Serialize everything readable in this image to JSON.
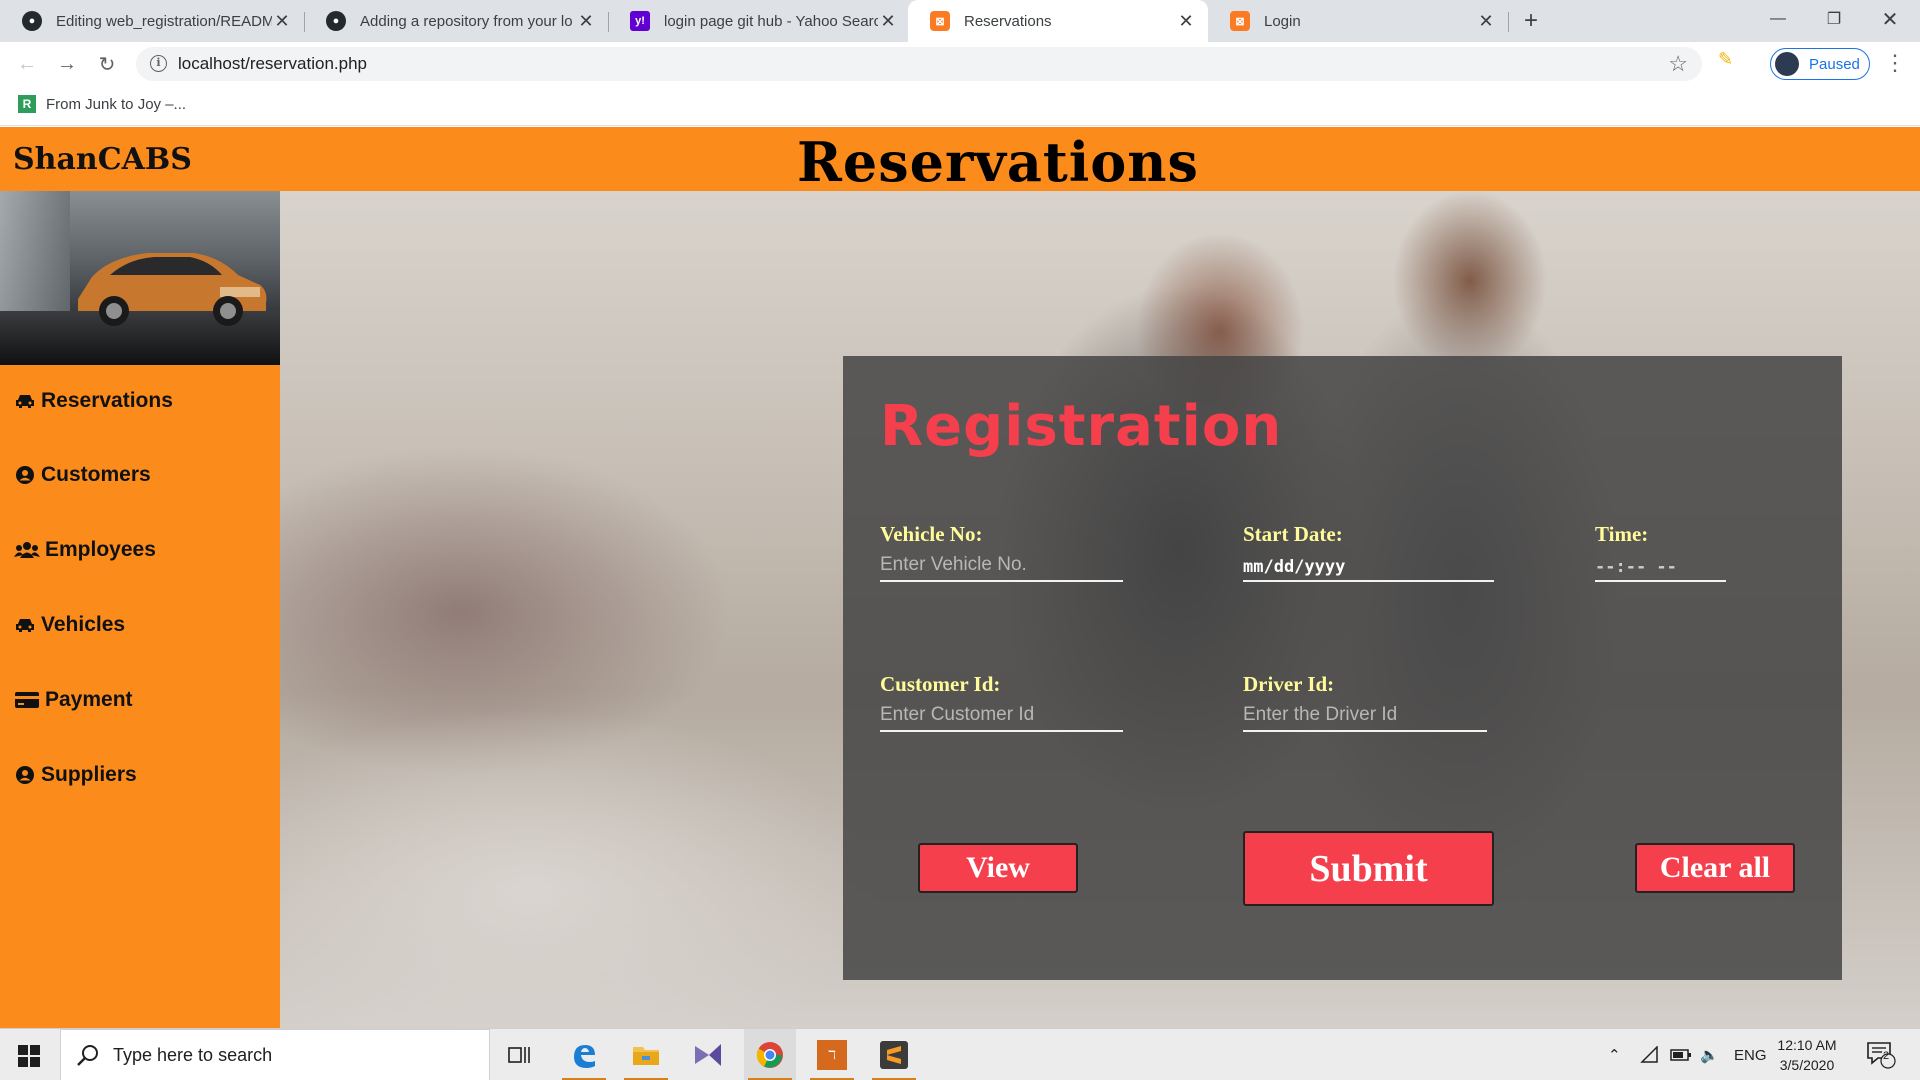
{
  "browser": {
    "tabs": [
      {
        "title": "Editing web_registration/READM",
        "favicon": "github-icon"
      },
      {
        "title": "Adding a repository from your lo",
        "favicon": "github-icon"
      },
      {
        "title": "login page git hub - Yahoo Searc",
        "favicon": "yahoo-icon"
      },
      {
        "title": "Reservations",
        "favicon": "xampp-icon",
        "active": true
      },
      {
        "title": "Login",
        "favicon": "xampp-icon"
      }
    ],
    "url": "localhost/reservation.php",
    "profile_label": "Paused",
    "bookmark": "From Junk to Joy –..."
  },
  "page": {
    "brand": "ShanCABS",
    "title": "Reservations",
    "accent_color": "#fb8c1c",
    "sidebar": [
      {
        "label": "Reservations",
        "icon": "car-icon"
      },
      {
        "label": "Customers",
        "icon": "user-circle-icon"
      },
      {
        "label": "Employees",
        "icon": "users-icon"
      },
      {
        "label": "Vehicles",
        "icon": "car-icon"
      },
      {
        "label": "Payment",
        "icon": "credit-card-icon"
      },
      {
        "label": "Suppliers",
        "icon": "user-circle-icon"
      }
    ],
    "form": {
      "heading": "Registration",
      "vehicle_no": {
        "label": "Vehicle No:",
        "placeholder": "Enter Vehicle No."
      },
      "start_date": {
        "label": "Start Date:",
        "value": "mm/dd/yyyy"
      },
      "time": {
        "label": "Time:",
        "value": "--:-- --"
      },
      "customer_id": {
        "label": "Customer Id:",
        "placeholder": "Enter Customer Id"
      },
      "driver_id": {
        "label": "Driver Id:",
        "placeholder": "Enter the Driver Id"
      },
      "buttons": {
        "view": "View",
        "submit": "Submit",
        "clear": "Clear all"
      }
    }
  },
  "taskbar": {
    "search_placeholder": "Type here to search",
    "language": "ENG",
    "time": "12:10 AM",
    "date": "3/5/2020",
    "notification_count": "2"
  }
}
